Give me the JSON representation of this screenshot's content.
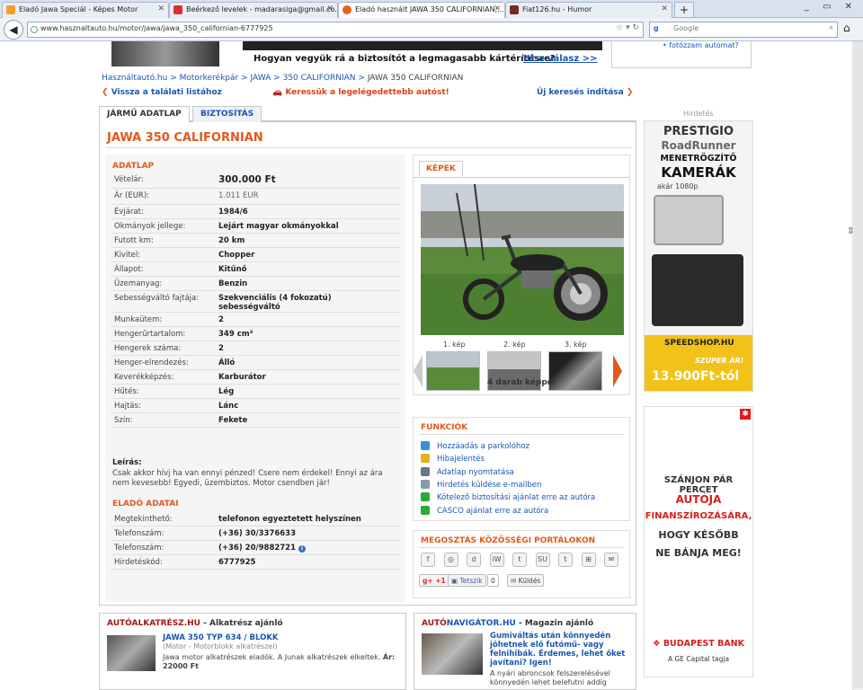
{
  "browser": {
    "tabs": [
      {
        "label": "Eladó Jawa Speciál - Képes Motor",
        "fav": "#f0a030"
      },
      {
        "label": "Beérkező levelek - madarasiga@gmail.co...",
        "fav": "#d9302a"
      },
      {
        "label": "Eladó használt JAWA 350 CALIFORNIAN,...",
        "fav": "#e8641e"
      },
      {
        "label": "Fiat126.hu - Humor",
        "fav": "#7a2a20"
      }
    ],
    "new_tab": "+",
    "window_buttons": "_ ▭ ✕",
    "url": "www.hasznaltauto.hu/motor/jawa/jawa_350_californian-6777925",
    "search_placeholder": "Google",
    "search_engine": "g"
  },
  "banner": {
    "text": "Hogyan vegyük rá a biztosítót a legmagasabb kártérítésre?",
    "link": "Itt a válasz >>",
    "topright": "fotózzam automat?"
  },
  "breadcrumb": {
    "items": [
      "Használtautó.hu",
      "Motorkerékpár",
      "JAWA",
      "350 CALIFORNIAN"
    ],
    "current": "JAWA 350 CALIFORNIAN",
    "sep": ">"
  },
  "nav": {
    "back": "Vissza a találati listához",
    "cheapest": "Keressük a legelégedettebb autóst!",
    "new_search": "Új keresés indítása"
  },
  "subtabs": [
    "JÁRMŰ ADATLAP",
    "BIZTOSÍTÁS"
  ],
  "title": "JAWA 350 CALIFORNIAN",
  "adatlap": {
    "heading": "ADATLAP",
    "rows": [
      {
        "k": "Vételár:",
        "v": "300.000 Ft"
      },
      {
        "k": "Ár (EUR):",
        "v": "1.011 EUR"
      },
      {
        "k": "Évjárat:",
        "v": "1984/6"
      },
      {
        "k": "Okmányok jellege:",
        "v": "Lejárt magyar okmányokkal"
      },
      {
        "k": "Futott km:",
        "v": "20 km"
      },
      {
        "k": "Kivitel:",
        "v": "Chopper"
      },
      {
        "k": "Állapot:",
        "v": "Kitűnő"
      },
      {
        "k": "Üzemanyag:",
        "v": "Benzin"
      },
      {
        "k": "Sebességváltó fajtája:",
        "v": "Szekvenciális (4 fokozatú) sebességváltó"
      },
      {
        "k": "Munkaütem:",
        "v": "2"
      },
      {
        "k": "Hengerűrtartalom:",
        "v": "349 cm³"
      },
      {
        "k": "Hengerek száma:",
        "v": "2"
      },
      {
        "k": "Henger-elrendezés:",
        "v": "Álló"
      },
      {
        "k": "Keverékképzés:",
        "v": "Karburátor"
      },
      {
        "k": "Hűtés:",
        "v": "Lég"
      },
      {
        "k": "Hajtás:",
        "v": "Lánc"
      },
      {
        "k": "Szín:",
        "v": "Fekete"
      }
    ],
    "desc_label": "Leírás:",
    "desc": "Csak akkor hívj ha van ennyi pénzed! Csere nem érdekel! Ennyi az ára nem kevesebb! Egyedi, üzembiztos. Motor csendben jár!"
  },
  "elado": {
    "heading": "ELADÓ ADATAI",
    "rows": [
      {
        "k": "Megtekinthető:",
        "v": "telefonon egyeztetett helyszínen"
      },
      {
        "k": "Telefonszám:",
        "v": "(+36) 30/3376633"
      },
      {
        "k": "Telefonszám:",
        "v": "(+36) 20/9882721"
      },
      {
        "k": "Hirdetéskód:",
        "v": "6777925"
      }
    ],
    "info_icon": "i"
  },
  "kepek": {
    "tab": "KÉPEK",
    "labels": [
      "1. kép",
      "2. kép",
      "3. kép"
    ],
    "count": "4 darab képpel"
  },
  "funkciok": {
    "heading": "FUNKCIÓK",
    "items": [
      {
        "label": "Hozzáadás a parkolóhoz",
        "color": "#3a8fd8",
        "icon": "parking-icon"
      },
      {
        "label": "Hibajelentés",
        "color": "#e8b020",
        "icon": "warning-icon"
      },
      {
        "label": "Adatlap nyomtatása",
        "color": "#667788",
        "icon": "print-icon"
      },
      {
        "label": "Hirdetés küldése e-mailben",
        "color": "#8899aa",
        "icon": "mail-icon"
      },
      {
        "label": "Kötelező biztosítási ajánlat erre az autóra",
        "color": "#2da83a",
        "icon": "check-icon"
      },
      {
        "label": "CASCO ajánlat erre az autóra",
        "color": "#2da83a",
        "icon": "check-icon"
      }
    ]
  },
  "share": {
    "heading": "MEGOSZTÁS KÖZÖSSÉGI PORTÁLOKON",
    "icons": [
      "f",
      "◎",
      "d",
      "iW",
      "t",
      "SU",
      "t",
      "⊞",
      "✉"
    ],
    "gplus": "g+ +1",
    "like": "Tetszik",
    "like_count": "0",
    "send": "Küldés"
  },
  "bottom_left": {
    "brand_a": "AUTÓALKATRÉSZ",
    "brand_b": ".HU",
    "sub": "- Alkatrész ajánló",
    "item_title": "JAWA 350 TYP 634 / BLOKK",
    "item_cat": "(Motor - Motorblokk alkatrészei)",
    "item_desc": "Jawa motor alkatrészek eladók. A Junak alkatrészek elkeltek.",
    "item_price_label": "Ár:",
    "item_price": "22000 Ft"
  },
  "bottom_right": {
    "brand_a": "AUTÓ",
    "brand_b": "NAVIGÁTOR.HU",
    "sub": "- Magazin ajánló",
    "item_title": "Gumiváltás után könnyedén jöhetnek elő futómű- vagy felnihibák. Érdemes, lehet őket javítani? Igen!",
    "item_desc": "A nyári abroncsok felszerelésével könnyedén lehet belefutni addig"
  },
  "ads": {
    "label": "Hirdetés",
    "ad1": {
      "l1": "PRESTIGIO",
      "l2": "RoadRunner",
      "l3": "MENETRÖGZÍTŐ",
      "l4": "KAMERÁK",
      "l5": "akár 1080p",
      "l6": "SPEEDSHOP.HU",
      "l7": "SZUPER ÁR!",
      "l8": "13.900Ft-tól"
    },
    "ad2": {
      "l1": "SZÁNJON PÁR PERCET",
      "l2": "AUTÓJA",
      "l3": "FINANSZÍROZÁSÁRA,",
      "l4": "HOGY KÉSŐBB",
      "l5": "NE BÁNJA MEG!",
      "l6": "BUDAPEST BANK",
      "l7": "A GE Capital tagja"
    }
  }
}
